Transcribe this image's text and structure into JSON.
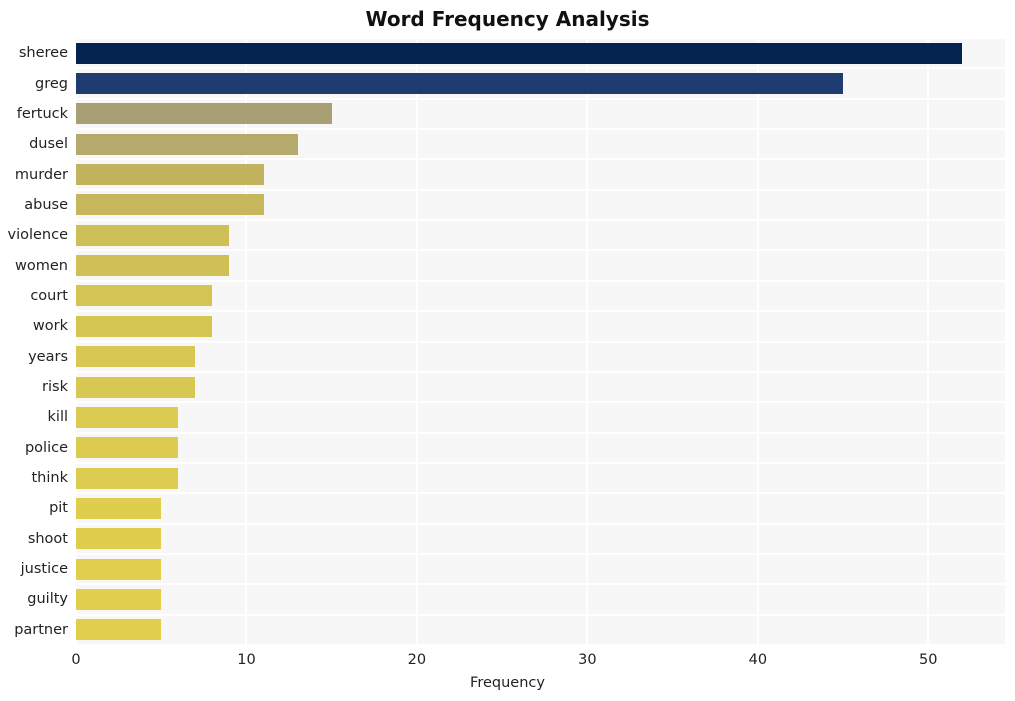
{
  "chart_data": {
    "type": "bar",
    "orientation": "horizontal",
    "title": "Word Frequency Analysis",
    "xlabel": "Frequency",
    "ylabel": "",
    "xlim": [
      0,
      54.5
    ],
    "ylim": [
      0,
      20
    ],
    "grid": true,
    "legend": false,
    "xticks": [
      "0",
      "10",
      "20",
      "30",
      "40",
      "50"
    ],
    "xtick_values": [
      0,
      10,
      20,
      30,
      40,
      50
    ],
    "categories": [
      "sheree",
      "greg",
      "fertuck",
      "dusel",
      "murder",
      "abuse",
      "violence",
      "women",
      "court",
      "work",
      "years",
      "risk",
      "kill",
      "police",
      "think",
      "pit",
      "shoot",
      "justice",
      "guilty",
      "partner"
    ],
    "values": [
      52,
      45,
      15,
      13,
      11,
      11,
      9,
      9,
      8,
      8,
      7,
      7,
      6,
      6,
      6,
      5,
      5,
      5,
      5,
      5
    ],
    "bar_colors": [
      "#04244f",
      "#1f3c70",
      "#a89f74",
      "#b6a96c",
      "#c2b35f",
      "#c6b75d",
      "#cfbf57",
      "#d0c056",
      "#d4c454",
      "#d5c553",
      "#d8c851",
      "#d8c851",
      "#dbcb50",
      "#dbcb50",
      "#dccc4f",
      "#dfcd4e",
      "#dfcd4e",
      "#e0ce4d",
      "#e0ce4d",
      "#e0ce4d"
    ],
    "plot_bg": "#f7f7f7",
    "grid_color": "#ffffff",
    "figure_bg": "#ffffff",
    "text_color": "#232323"
  }
}
